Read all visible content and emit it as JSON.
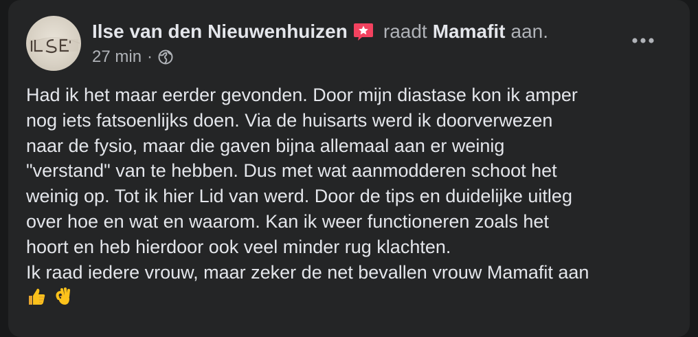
{
  "post": {
    "author": {
      "name": "Ilse van den Nieuwenhuizen",
      "avatar_text": "ILSE",
      "badge_icon": "recommendation-star-icon",
      "badge_color": "#f3425f"
    },
    "action_verb": "raadt",
    "target_page": "Mamafit",
    "action_suffix": "aan.",
    "timestamp": "27 min",
    "meta_separator": "·",
    "privacy_icon": "globe-icon",
    "more_icon": "more-options-icon",
    "body_lines": [
      "Had ik het maar eerder gevonden. Door mijn diastase kon ik amper",
      "nog iets fatsoenlijks doen. Via de huisarts werd ik doorverwezen",
      "naar de fysio, maar die gaven bijna allemaal aan er weinig",
      "\"verstand\" van te hebben. Dus met wat aanmodderen schoot het",
      "weinig op. Tot ik hier Lid van werd. Door de tips en duidelijke uitleg",
      "over hoe en wat en waarom. Kan ik weer functioneren zoals het",
      "hoort en heb hierdoor ook veel minder rug klachten.",
      "Ik raad iedere vrouw, maar zeker de net bevallen vrouw Mamafit aan"
    ],
    "body_emojis": [
      "thumbs-up-icon",
      "ok-hand-icon"
    ]
  },
  "colors": {
    "card_background": "#242526",
    "page_background": "#18191a",
    "primary_text": "#e4e6eb",
    "secondary_text": "#b0b3b8"
  }
}
